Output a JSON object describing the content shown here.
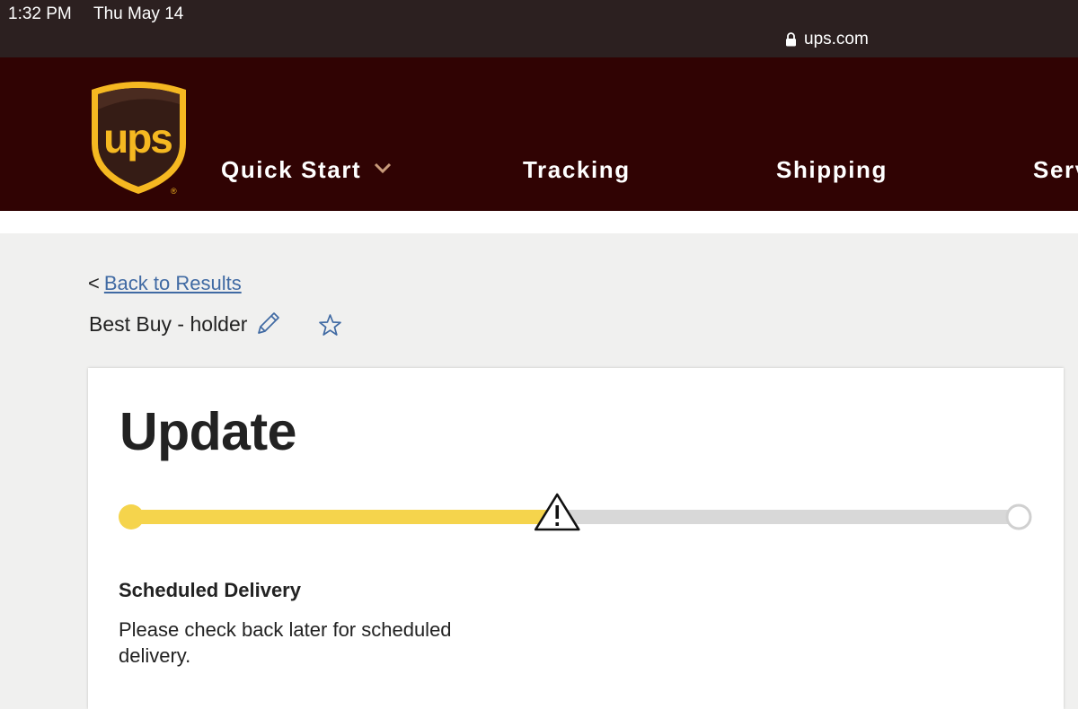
{
  "status_bar": {
    "time": "1:32 PM",
    "date": "Thu May 14",
    "url": "ups.com",
    "lock_icon": "lock-icon"
  },
  "header": {
    "logo_icon": "ups-shield-logo",
    "logo_text": "ups",
    "colors": {
      "background": "#300303",
      "logo_gold": "#f5b821",
      "logo_brown": "#351c15"
    },
    "nav": [
      {
        "label": "Quick Start",
        "has_dropdown": true
      },
      {
        "label": "Tracking"
      },
      {
        "label": "Shipping"
      },
      {
        "label": "Serv"
      }
    ]
  },
  "breadcrumb": {
    "back_symbol": "<",
    "back_label": "Back to Results"
  },
  "package": {
    "name": "Best Buy - holder",
    "edit_icon": "pencil-icon",
    "favorite_icon": "star-icon"
  },
  "status_card": {
    "title": "Update",
    "progress": {
      "fraction": 0.48,
      "alert_icon": "warning-triangle-icon",
      "filled_color": "#f5d44c",
      "track_color": "#d8d8d8"
    },
    "scheduled_label": "Scheduled Delivery",
    "scheduled_text": "Please check back later for scheduled delivery."
  }
}
